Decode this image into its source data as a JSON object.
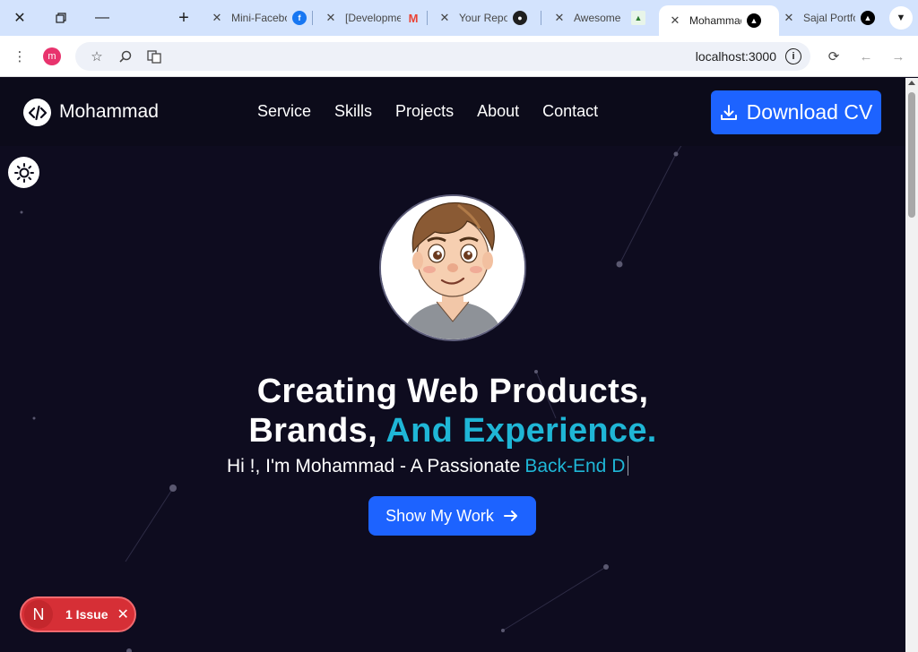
{
  "browser": {
    "tabs": [
      {
        "title": "Mini-Facebook",
        "favicon": "facebook-icon",
        "color": "#1877f2"
      },
      {
        "title": "[Development]",
        "favicon": "gmail-icon",
        "color": "#ea4335"
      },
      {
        "title": "Your Repositories",
        "favicon": "github-icon",
        "color": "#1f1f1f"
      },
      {
        "title": "Awesome",
        "favicon": "image-icon",
        "color": "#2e7d32"
      },
      {
        "title": "Mohammad",
        "favicon": "nextjs-icon",
        "color": "#000000"
      },
      {
        "title": "Sajal Portfolio",
        "favicon": "nextjs-icon",
        "color": "#000000"
      }
    ],
    "profile_initial": "m",
    "url": "localhost:3000"
  },
  "nav": {
    "logo_text": "Mohammad",
    "links": [
      "Service",
      "Skills",
      "Projects",
      "About",
      "Contact"
    ],
    "cta_label": "Download CV"
  },
  "hero": {
    "headline_line1": "Creating Web Products,",
    "headline_line2_plain": "Brands,",
    "headline_line2_accent": "And Experience.",
    "subline_plain": "Hi !, I'm Mohammad - A Passionate",
    "subline_typed": "Back-End D",
    "button_label": "Show My Work"
  },
  "dev_overlay": {
    "badge_letter": "N",
    "issue_label": "1 Issue"
  },
  "colors": {
    "background": "#0e0c1f",
    "accent_cyan": "#1fb6d6",
    "primary_blue": "#1d63ff",
    "issue_red": "#d62f36"
  }
}
